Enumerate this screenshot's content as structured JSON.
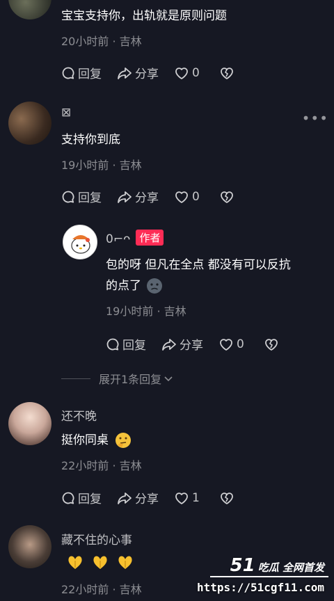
{
  "comments": [
    {
      "username": "",
      "text": "宝宝支持你，出轨就是原则问题",
      "meta": "20小时前 · 吉林",
      "actions": {
        "reply": "回复",
        "share": "分享",
        "likes": "0"
      }
    },
    {
      "username": "⊠",
      "text": "支持你到底",
      "meta": "19小时前 · 吉林",
      "actions": {
        "reply": "回复",
        "share": "分享",
        "likes": "0"
      }
    },
    {
      "username": "0⌐ᴖ",
      "badge": "作者",
      "text_line1": "包的呀 但凡在全点 都没有可以反抗",
      "text_line2": "的点了",
      "meta": "19小时前 · 吉林",
      "actions": {
        "reply": "回复",
        "share": "分享",
        "likes": "0"
      }
    },
    {
      "username": "还不晚",
      "text": "挺你同桌",
      "meta": "22小时前 · 吉林",
      "actions": {
        "reply": "回复",
        "share": "分享",
        "likes": "1"
      }
    },
    {
      "username": "藏不住的心事",
      "text": "",
      "meta": "22小时前 · 吉林"
    }
  ],
  "expand_replies": "展开1条回复",
  "watermark": {
    "brand_num": "51",
    "brand_text": "吃瓜 全网首发",
    "url": "https://51cgf11.com"
  },
  "colors": {
    "background": "#161823",
    "author_badge": "#fe2c55"
  }
}
